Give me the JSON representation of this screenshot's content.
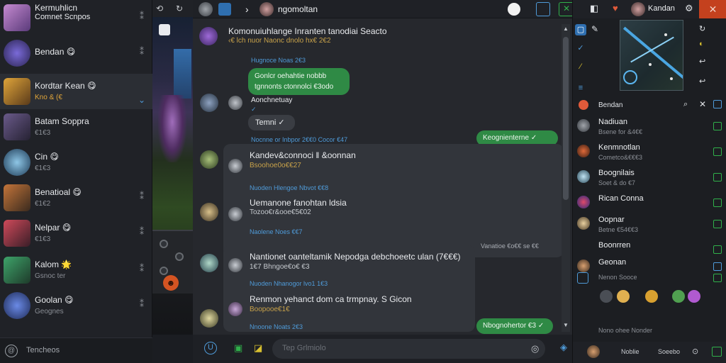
{
  "left": {
    "header": {
      "title": "Kermuhlicn",
      "subtitle": "Comnet Scnpos"
    },
    "conversations": [
      {
        "name": "Kermuhlicn",
        "sub": "Comnet Scnpos",
        "badge": ""
      },
      {
        "name": "Bendan",
        "sub": "",
        "badge": "😋"
      },
      {
        "name": "Kordtar Kean",
        "sub": "Kno & (€",
        "badge": "😋"
      },
      {
        "name": "Batam Soppra",
        "sub": "€1€3",
        "badge": ""
      },
      {
        "name": "Cin",
        "sub": "€1€3",
        "badge": "😋"
      },
      {
        "name": "Benatioal",
        "sub": "€1€2",
        "badge": "😋"
      },
      {
        "name": "Nelpar",
        "sub": "€1€3",
        "badge": "😋"
      },
      {
        "name": "Kalom",
        "sub": "Gsnoc ter",
        "badge": "🌟"
      },
      {
        "name": "Goolan",
        "sub": "Geognes",
        "badge": "😋"
      }
    ],
    "search_text": "Tencheos"
  },
  "chat": {
    "header_name": "ngomoltan",
    "composer_placeholder": "Tep Grlmiolo",
    "messages": [
      {
        "kind": "in",
        "text": "Komonuiuhlange Inranten tanodiai Seacto",
        "sub": "‹€ lch nuor Naonc dnolo hx€ 2€2"
      },
      {
        "kind": "time",
        "text": "Hugnoce Noas 2€3"
      },
      {
        "kind": "out-green-left",
        "line1": "Gonlcr oehahtie nobbb",
        "line2": "tgnnonts ctonnolci €3odo"
      },
      {
        "kind": "pill",
        "text": "Temni ✓"
      },
      {
        "kind": "sender",
        "text": "Aonchnetuay"
      },
      {
        "kind": "out-green",
        "text": "Keognienterne ✓"
      },
      {
        "kind": "time",
        "text": "Nocnne or Inbpor 2€€0 Cocor €47"
      },
      {
        "kind": "in",
        "text": "Kandev&connoci ‖ &oonnan",
        "sub": "Bsoohoe0o€€27"
      },
      {
        "kind": "time",
        "text": "Nuoden Hlengoe Nbvot €€8"
      },
      {
        "kind": "in",
        "text": "Uemanone fanohtan ldsia",
        "sub": "Tozoo€r&ooe€5€02"
      },
      {
        "kind": "time",
        "text": "Naolene Noes €€7"
      },
      {
        "kind": "time-r",
        "text": "Vanatioe €o€€ se €€"
      },
      {
        "kind": "in",
        "text": "Nantionet oanteltamik Nepodga debchoeetc ulan (7€€€)",
        "sub": "1€7 Bhngoe€o€ €3"
      },
      {
        "kind": "time",
        "text": "Nuoden Nhanogor lvo1 1€3"
      },
      {
        "kind": "in",
        "text": "Renmon yehanct dom ca trmpnay. S Gicon",
        "sub": "Boopooe€1€"
      },
      {
        "kind": "time",
        "text": "Nnoone Noats 2€3"
      },
      {
        "kind": "out-green",
        "text": "Nbognohertor €3 ✓"
      }
    ]
  },
  "right": {
    "header_title": "Kandan",
    "list_title": "Bendan",
    "people": [
      {
        "name": "Nadiuan",
        "sub": "Bsene for &4€€"
      },
      {
        "name": "Kenmnotlan",
        "sub": "Cometco&€€€3"
      },
      {
        "name": "Boognilais",
        "sub": "Soet & do €7"
      },
      {
        "name": "Rican Conna",
        "sub": ""
      },
      {
        "name": "Oopnar",
        "sub": "Betne €54€€3"
      },
      {
        "name": "Boonrren",
        "sub": ""
      },
      {
        "name": "Geonan",
        "sub": "Nenon Sooce"
      }
    ],
    "footer_left": "Nono ohee Nonder",
    "footer_mid": "Noblie",
    "footer_right": "Soeebo"
  },
  "colors": {
    "accent_green": "#2f8a45",
    "accent_blue": "#4f9bd9",
    "bg": "#26282d"
  },
  "icons": [
    "pin-icon",
    "search-icon",
    "chevron-right-icon",
    "close-icon",
    "gear-icon",
    "check-icon",
    "send-icon",
    "emoji-icon",
    "attach-icon",
    "mic-icon"
  ]
}
